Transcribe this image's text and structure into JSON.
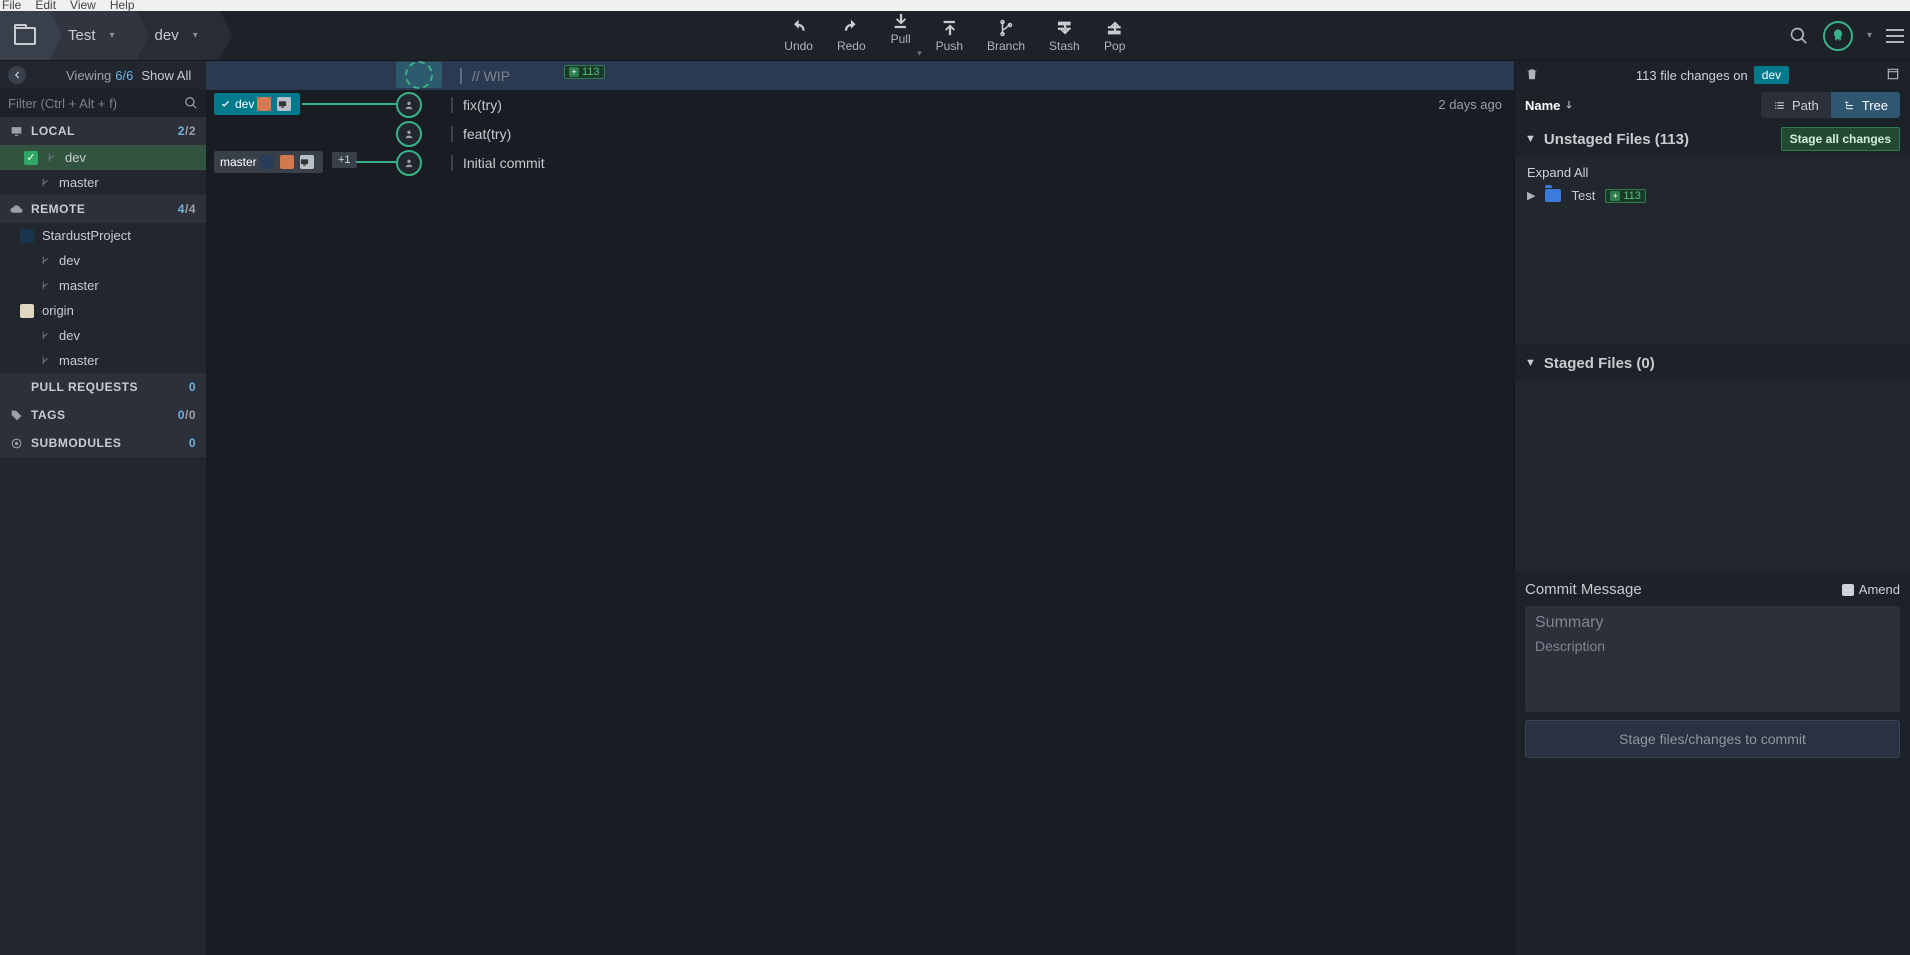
{
  "os_menu": {
    "file": "File",
    "edit": "Edit",
    "view": "View",
    "help": "Help"
  },
  "breadcrumb": {
    "repo": "Test",
    "branch": "dev"
  },
  "actions": {
    "undo": "Undo",
    "redo": "Redo",
    "pull": "Pull",
    "push": "Push",
    "branch": "Branch",
    "stash": "Stash",
    "pop": "Pop"
  },
  "sidebar": {
    "viewing_label": "Viewing",
    "viewing_count": "6/6",
    "show_all": "Show All",
    "filter_placeholder": "Filter (Ctrl + Alt + f)",
    "sections": {
      "local": {
        "title": "LOCAL",
        "count": "2",
        "count2": "/2"
      },
      "remote": {
        "title": "REMOTE",
        "count": "4",
        "count2": "/4"
      },
      "pull_requests": {
        "title": "PULL REQUESTS",
        "count": "0"
      },
      "tags": {
        "title": "TAGS",
        "count": "0",
        "count2": "/0"
      },
      "submodules": {
        "title": "SUBMODULES",
        "count": "0"
      }
    },
    "local": {
      "dev": "dev",
      "master": "master"
    },
    "remotes": {
      "stardust": "StardustProject",
      "stardust_dev": "dev",
      "stardust_master": "master",
      "origin": "origin",
      "origin_dev": "dev",
      "origin_master": "master"
    }
  },
  "graph": {
    "wip_label": "// WIP",
    "wip_count": "113",
    "rows": [
      {
        "message": "fix(try)"
      },
      {
        "message": "feat(try)"
      },
      {
        "message": "Initial commit"
      }
    ],
    "time": "2 days ago",
    "tags": {
      "dev": "dev",
      "master": "master",
      "more": "+1"
    }
  },
  "right": {
    "file_changes_pre": "113 file changes on",
    "branch_pill": "dev",
    "name_label": "Name",
    "seg_path": "Path",
    "seg_tree": "Tree",
    "unstaged_title": "Unstaged Files (113)",
    "stage_all": "Stage all changes",
    "expand_all": "Expand All",
    "folder_name": "Test",
    "folder_count": "113",
    "staged_title": "Staged Files (0)",
    "commit_message_label": "Commit Message",
    "amend_label": "Amend",
    "summary_placeholder": "Summary",
    "description_placeholder": "Description",
    "commit_btn": "Stage files/changes to commit"
  }
}
